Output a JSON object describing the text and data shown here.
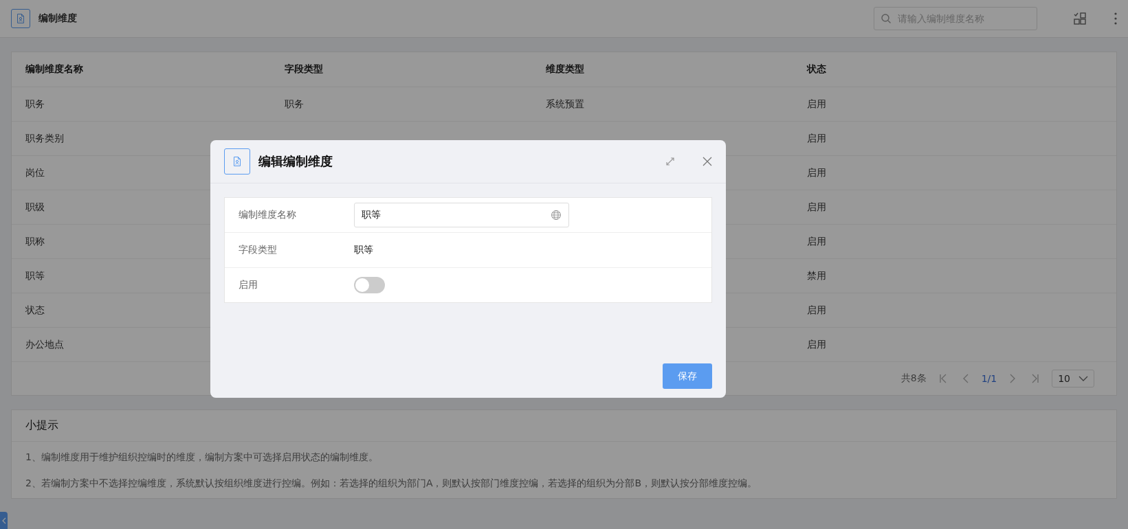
{
  "header": {
    "title": "编制维度",
    "search": {
      "placeholder": "请输入编制维度名称"
    }
  },
  "table": {
    "columns": [
      "编制维度名称",
      "字段类型",
      "维度类型",
      "状态"
    ],
    "rows": [
      {
        "cells": [
          "职务",
          "职务",
          "系统预置",
          "启用"
        ]
      },
      {
        "cells": [
          "职务类别",
          null,
          null,
          "启用"
        ]
      },
      {
        "cells": [
          "岗位",
          null,
          null,
          "启用"
        ]
      },
      {
        "cells": [
          "职级",
          null,
          null,
          "启用"
        ]
      },
      {
        "cells": [
          "职称",
          null,
          null,
          "启用"
        ]
      },
      {
        "cells": [
          "职等",
          null,
          null,
          "禁用"
        ]
      },
      {
        "cells": [
          "状态",
          null,
          null,
          "启用"
        ]
      },
      {
        "cells": [
          "办公地点",
          null,
          null,
          "启用"
        ]
      }
    ],
    "pagination": {
      "total": "共8条",
      "page": "1/1",
      "page_size": "10"
    }
  },
  "tips": {
    "title": "小提示",
    "lines": [
      "1、编制维度用于维护组织控编时的维度，编制方案中可选择启用状态的编制维度。",
      "2、若编制方案中不选择控编维度，系统默认按组织维度进行控编。例如：若选择的组织为部门A，则默认按部门维度控编，若选择的组织为分部B，则默认按分部维度控编。"
    ]
  },
  "modal": {
    "title": "编辑编制维度",
    "fields": [
      {
        "kind": "input",
        "label": "编制维度名称",
        "value": "职等"
      },
      {
        "kind": "text",
        "label": "字段类型",
        "value": "职等"
      },
      {
        "kind": "switch",
        "label": "启用",
        "on": false
      }
    ],
    "save": "保存"
  }
}
